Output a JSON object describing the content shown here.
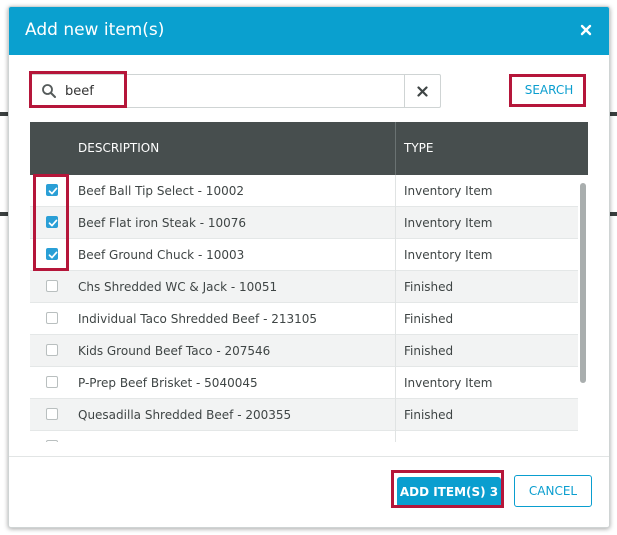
{
  "dialog": {
    "title": "Add new item(s)",
    "close_icon": "close-icon"
  },
  "search": {
    "value": "beef",
    "placeholder": "",
    "search_icon": "search-icon",
    "clear_icon": "clear-icon",
    "button_label": "SEARCH"
  },
  "table": {
    "columns": [
      "DESCRIPTION",
      "TYPE"
    ],
    "rows": [
      {
        "description": "Beef Ball Tip Select - 10002",
        "type": "Inventory Item",
        "checked": true
      },
      {
        "description": "Beef Flat iron Steak - 10076",
        "type": "Inventory Item",
        "checked": true
      },
      {
        "description": "Beef Ground Chuck - 10003",
        "type": "Inventory Item",
        "checked": true
      },
      {
        "description": "Chs Shredded WC & Jack - 10051",
        "type": "Finished",
        "checked": false
      },
      {
        "description": "Individual Taco Shredded Beef - 213105",
        "type": "Finished",
        "checked": false
      },
      {
        "description": "Kids Ground Beef Taco - 207546",
        "type": "Finished",
        "checked": false
      },
      {
        "description": "P-Prep Beef Brisket - 5040045",
        "type": "Inventory Item",
        "checked": false
      },
      {
        "description": "Quesadilla Shredded Beef - 200355",
        "type": "Finished",
        "checked": false
      },
      {
        "description": "",
        "type": "",
        "checked": false
      }
    ]
  },
  "footer": {
    "add_label": "ADD ITEM(S) 3",
    "cancel_label": "CANCEL"
  },
  "colors": {
    "header": "#0aa0cf",
    "accent": "#0a9ecf",
    "table_header": "#474e4e",
    "highlight": "#b5163a"
  }
}
